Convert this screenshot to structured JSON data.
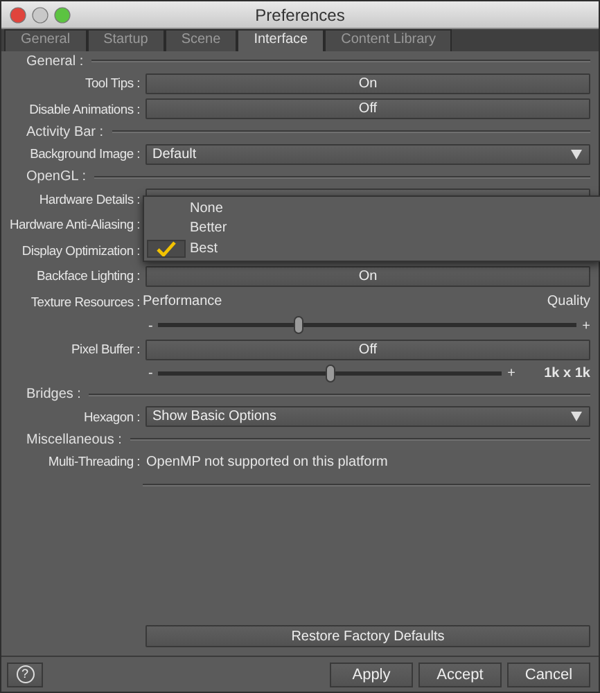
{
  "window": {
    "title": "Preferences"
  },
  "tabs": [
    {
      "label": "General",
      "selected": false
    },
    {
      "label": "Startup",
      "selected": false
    },
    {
      "label": "Scene",
      "selected": false
    },
    {
      "label": "Interface",
      "selected": true
    },
    {
      "label": "Content Library",
      "selected": false
    }
  ],
  "sections": [
    {
      "title": "General :",
      "rows": [
        {
          "kind": "button",
          "label": "Tool Tips :",
          "value": "On"
        },
        {
          "kind": "button",
          "label": "Disable Animations :",
          "value": "Off"
        }
      ]
    },
    {
      "title": "Activity Bar :",
      "rows": [
        {
          "kind": "select",
          "label": "Background Image :",
          "value": "Default"
        }
      ]
    },
    {
      "title": "OpenGL :",
      "rows": [
        {
          "kind": "blank",
          "label": "Hardware Details :"
        },
        {
          "kind": "covered",
          "label": "Hardware Anti-Aliasing :"
        },
        {
          "kind": "covered",
          "label": "Display Optimization :"
        },
        {
          "kind": "button",
          "label": "Backface Lighting :",
          "value": "On"
        },
        {
          "kind": "captions",
          "label": "Texture Resources :",
          "min_text": "Performance",
          "max_text": "Quality"
        },
        {
          "kind": "slider",
          "minus": "-",
          "plus": "+",
          "level": 0.335
        },
        {
          "kind": "button",
          "label": "Pixel Buffer :",
          "value": "Off"
        },
        {
          "kind": "slider",
          "minus": "-",
          "plus": "+",
          "level": 0.5,
          "reading": "1k x 1k"
        }
      ]
    },
    {
      "title": "Bridges :",
      "rows": [
        {
          "kind": "select",
          "label": "Hexagon :",
          "value": "Show Basic Options"
        }
      ]
    },
    {
      "title": "Miscellaneous :",
      "rows": [
        {
          "kind": "text",
          "label": "Multi-Threading :",
          "value": "OpenMP not supported on this platform"
        }
      ]
    }
  ],
  "popup": {
    "options": [
      {
        "label": "None",
        "selected": false
      },
      {
        "label": "Better",
        "selected": false
      },
      {
        "label": "Best",
        "selected": true
      }
    ]
  },
  "restore_button": "Restore Factory Defaults",
  "help": "?",
  "buttons": [
    "Apply",
    "Accept",
    "Cancel"
  ]
}
